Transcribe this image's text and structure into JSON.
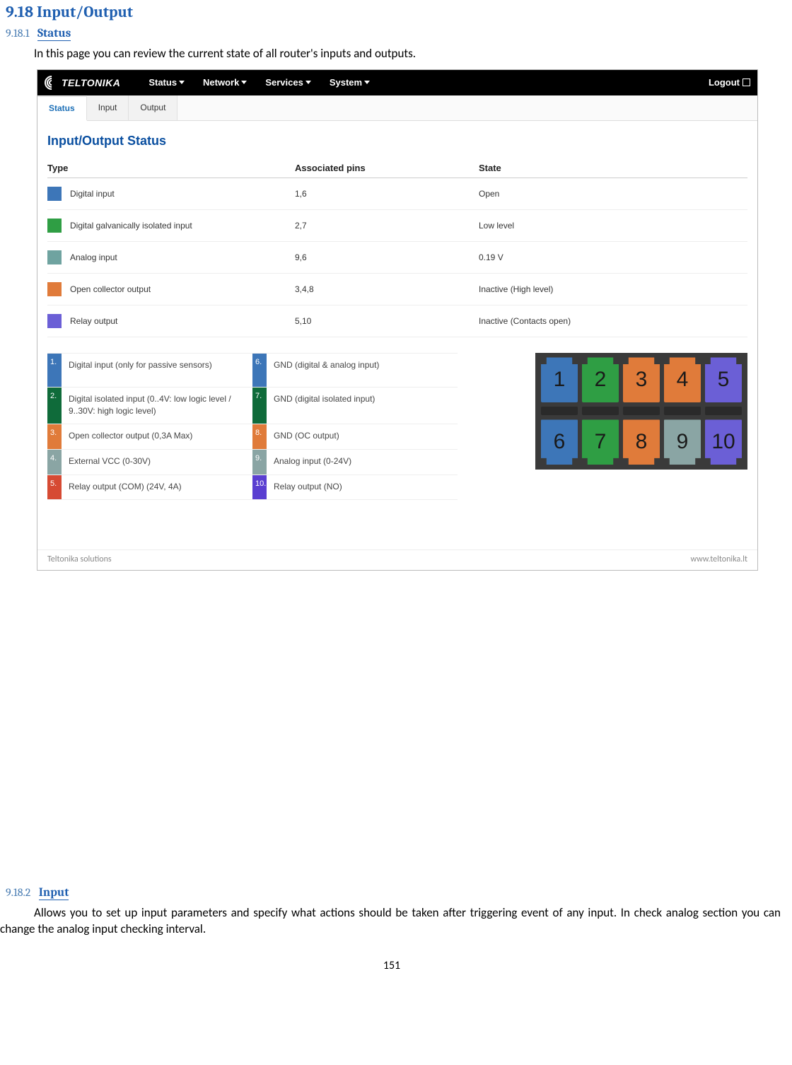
{
  "headings": {
    "h918": "9.18 Input/Output",
    "s9181_num": "9.18.1",
    "s9181_title": "Status",
    "s9182_num": "9.18.2",
    "s9182_title": "Input"
  },
  "text": {
    "status_intro": "In this page you can review the current state of all router's inputs and outputs.",
    "input_intro": "Allows you to set up input parameters and specify what actions should be taken after triggering event of any input. In check analog section you can change the analog input checking interval."
  },
  "nav": {
    "brand": "TELTONIKA",
    "items": [
      "Status",
      "Network",
      "Services",
      "System"
    ],
    "logout": "Logout"
  },
  "tabs": [
    "Status",
    "Input",
    "Output"
  ],
  "panel_title": "Input/Output Status",
  "status_table": {
    "headers": {
      "type": "Type",
      "pins": "Associated pins",
      "state": "State"
    },
    "rows": [
      {
        "color": "c-blue",
        "type": "Digital input",
        "pins": "1,6",
        "state": "Open"
      },
      {
        "color": "c-green",
        "type": "Digital galvanically isolated input",
        "pins": "2,7",
        "state": "Low level"
      },
      {
        "color": "c-teal",
        "type": "Analog input",
        "pins": "9,6",
        "state": "0.19 V"
      },
      {
        "color": "c-orange",
        "type": "Open collector output",
        "pins": "3,4,8",
        "state": "Inactive (High level)"
      },
      {
        "color": "c-purple",
        "type": "Relay output",
        "pins": "5,10",
        "state": "Inactive (Contacts open)"
      }
    ]
  },
  "legend_left": [
    {
      "n": "1.",
      "c": "c-blue",
      "t": "Digital input (only for passive sensors)"
    },
    {
      "n": "2.",
      "c": "c-dgreen",
      "t": "Digital isolated input (0..4V: low logic level / 9..30V: high logic level)"
    },
    {
      "n": "3.",
      "c": "c-orange",
      "t": "Open collector output (0,3A Max)"
    },
    {
      "n": "4.",
      "c": "c-gray",
      "t": "External VCC (0-30V)"
    },
    {
      "n": "5.",
      "c": "c-red",
      "t": "Relay output (COM) (24V, 4A)"
    }
  ],
  "legend_right": [
    {
      "n": "6.",
      "c": "c-blue",
      "t": "GND (digital & analog input)"
    },
    {
      "n": "7.",
      "c": "c-dgreen",
      "t": "GND (digital isolated input)"
    },
    {
      "n": "8.",
      "c": "c-orange",
      "t": "GND (OC output)"
    },
    {
      "n": "9.",
      "c": "c-gray",
      "t": "Analog input (0-24V)"
    },
    {
      "n": "10.",
      "c": "c-dpurple",
      "t": "Relay output (NO)"
    }
  ],
  "connector": {
    "top": [
      {
        "n": "1",
        "c": "#3d76b8"
      },
      {
        "n": "2",
        "c": "#2f9e44"
      },
      {
        "n": "3",
        "c": "#e07b3a"
      },
      {
        "n": "4",
        "c": "#e07b3a"
      },
      {
        "n": "5",
        "c": "#6b5fd6"
      }
    ],
    "bottom": [
      {
        "n": "6",
        "c": "#3d76b8"
      },
      {
        "n": "7",
        "c": "#2f9e44"
      },
      {
        "n": "8",
        "c": "#e07b3a"
      },
      {
        "n": "9",
        "c": "#8aa5a4"
      },
      {
        "n": "10",
        "c": "#6b5fd6"
      }
    ]
  },
  "shot_footer": {
    "left": "Teltonika solutions",
    "right": "www.teltonika.lt"
  },
  "page_number": "151"
}
